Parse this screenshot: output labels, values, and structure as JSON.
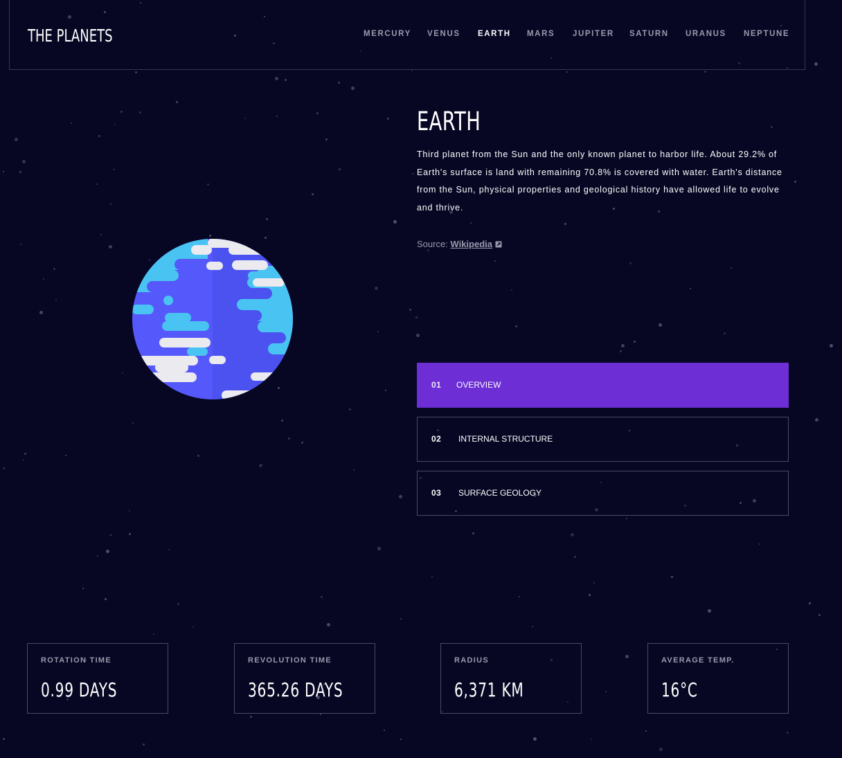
{
  "header": {
    "logo": "THE PLANETS",
    "nav": [
      {
        "label": "MERCURY",
        "active": false
      },
      {
        "label": "VENUS",
        "active": false
      },
      {
        "label": "EARTH",
        "active": true
      },
      {
        "label": "MARS",
        "active": false
      },
      {
        "label": "JUPITER",
        "active": false
      },
      {
        "label": "SATURN",
        "active": false
      },
      {
        "label": "URANUS",
        "active": false
      },
      {
        "label": "NEPTUNE",
        "active": false
      }
    ]
  },
  "planet": {
    "name": "EARTH",
    "description": "Third planet from the Sun and the only known planet to harbor life. About 29.2% of Earth's surface is land with remaining 70.8% is covered with water. Earth's distance from the Sun, physical properties and geological history have allowed life to evolve and thrive.",
    "source_prefix": "Source: ",
    "source_link": "Wikipedia",
    "image_icon": "earth-planet-illustration"
  },
  "tabs": [
    {
      "number": "01",
      "label": "OVERVIEW",
      "active": true
    },
    {
      "number": "02",
      "label": "INTERNAL STRUCTURE",
      "active": false
    },
    {
      "number": "03",
      "label": "SURFACE GEOLOGY",
      "active": false
    }
  ],
  "stats": [
    {
      "label": "ROTATION TIME",
      "value": "0.99 DAYS"
    },
    {
      "label": "REVOLUTION TIME",
      "value": "365.26 DAYS"
    },
    {
      "label": "RADIUS",
      "value": "6,371 KM"
    },
    {
      "label": "AVERAGE TEMP.",
      "value": "16°C"
    }
  ],
  "colors": {
    "background": "#070724",
    "accent": "#6d2ed5",
    "border": "#38384f",
    "muted_text": "#9a9aad"
  }
}
